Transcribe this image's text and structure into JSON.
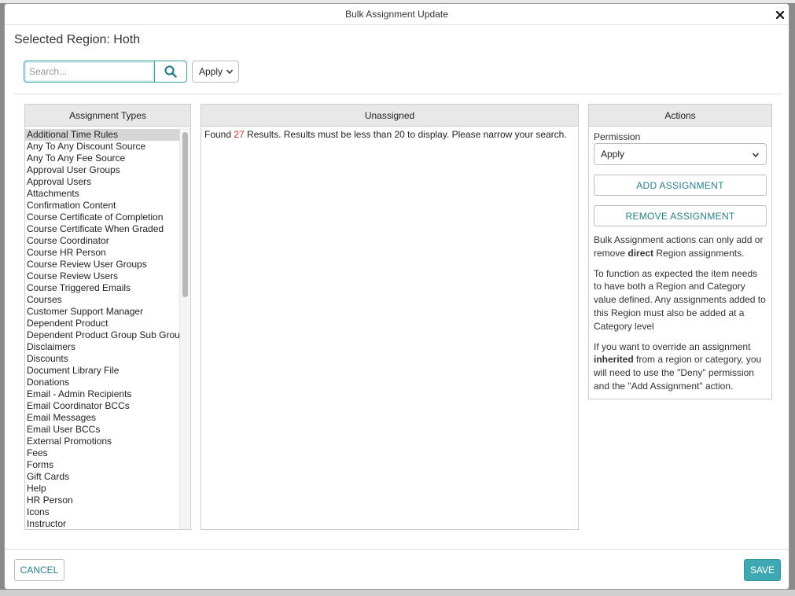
{
  "modal": {
    "title": "Bulk Assignment Update",
    "close_glyph": "✕",
    "region_heading": "Selected Region: Hoth"
  },
  "search": {
    "placeholder": "Search...",
    "value": "",
    "apply_select": "Apply"
  },
  "assignment_types": {
    "header": "Assignment Types",
    "selected": "Additional Time Rules",
    "items": [
      "Additional Time Rules",
      "Any To Any Discount Source",
      "Any To Any Fee Source",
      "Approval User Groups",
      "Approval Users",
      "Attachments",
      "Confirmation Content",
      "Course Certificate of Completion",
      "Course Certificate When Graded",
      "Course Coordinator",
      "Course HR Person",
      "Course Review User Groups",
      "Course Review Users",
      "Course Triggered Emails",
      "Courses",
      "Customer Support Manager",
      "Dependent Product",
      "Dependent Product Group Sub Group",
      "Disclaimers",
      "Discounts",
      "Document Library File",
      "Donations",
      "Email - Admin Recipients",
      "Email Coordinator BCCs",
      "Email Messages",
      "Email User BCCs",
      "External Promotions",
      "Fees",
      "Forms",
      "Gift Cards",
      "Help",
      "HR Person",
      "Icons",
      "Instructor"
    ]
  },
  "unassigned": {
    "header": "Unassigned",
    "found_prefix": "Found ",
    "count": "27",
    "found_suffix": " Results. Results must be less than 20 to display. Please narrow your search."
  },
  "actions": {
    "header": "Actions",
    "permission_label": "Permission",
    "permission_value": "Apply",
    "add_label": "ADD ASSIGNMENT",
    "remove_label": "REMOVE ASSIGNMENT",
    "note1_a": "Bulk Assignment actions can only add or remove ",
    "note1_b": "direct",
    "note1_c": " Region assignments.",
    "note2": "To function as expected the item needs to have both a Region and Category value defined. Any assignments added to this Region must also be added at a Category level",
    "note3_a": "If you want to override an assignment ",
    "note3_b": "inherited",
    "note3_c": " from a region or category, you will need to use the \"Deny\" permission and the \"Add Assignment\" action."
  },
  "footer": {
    "cancel_label": "CANCEL",
    "save_label": "SAVE"
  },
  "colors": {
    "accent": "#3fa9b3",
    "link": "#2a7f8a",
    "count": "#c0392b"
  }
}
